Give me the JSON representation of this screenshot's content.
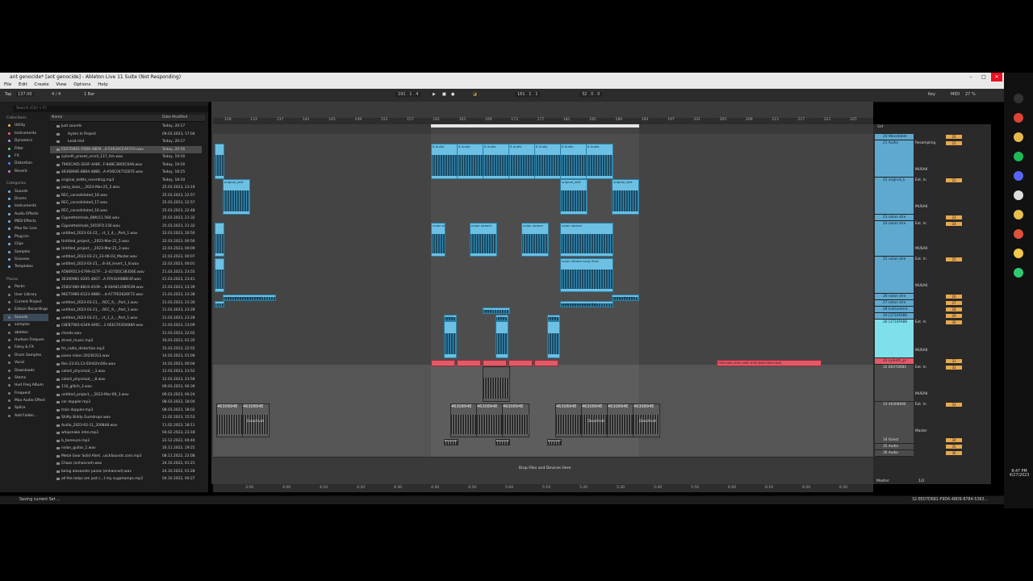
{
  "window": {
    "title": "ant genocide* [ant genocide] - Ableton Live 11 Suite (Not Responding)",
    "minimize": "–",
    "maximize": "□",
    "close": "✕"
  },
  "menu": [
    "File",
    "Edit",
    "Create",
    "View",
    "Options",
    "Help"
  ],
  "control": {
    "tap": "Tap",
    "tempo": "137.00",
    "signature": "4 / 4",
    "quantize": "1 Bar",
    "position": "191 .   1 .   4",
    "loop_start": "161 .   1 .   1",
    "loop_length": "32 .   0 .   0",
    "key": "Key",
    "midi": "MIDI",
    "cpu": "27 %"
  },
  "browser": {
    "search_placeholder": "Search (Ctrl + F)",
    "collections_header": "Collections",
    "collections": [
      {
        "label": "Utility",
        "color": "#e6a84e"
      },
      {
        "label": "Instruments",
        "color": "#e25a68"
      },
      {
        "label": "Dynamics",
        "color": "#b37ee0"
      },
      {
        "label": "Filter",
        "color": "#5fc36a"
      },
      {
        "label": "FX",
        "color": "#5fa9cf"
      },
      {
        "label": "Distortion",
        "color": "#4a7de0"
      },
      {
        "label": "Reverb",
        "color": "#c970c9"
      }
    ],
    "categories_header": "Categories",
    "categories": [
      "Sounds",
      "Drums",
      "Instruments",
      "Audio Effects",
      "MIDI Effects",
      "Max for Live",
      "Plug-ins",
      "Clips",
      "Samples",
      "Grooves",
      "Templates"
    ],
    "places_header": "Places",
    "places": [
      "Packs",
      "User Library",
      "Current Project",
      "Edison Recordings",
      "Sounds",
      "samples",
      "ableton",
      "Hudson Frequen",
      "Foley & FX",
      "Drum Samples",
      "Vocal",
      "Downloads",
      "Stems",
      "Hud Freq Album",
      "Frequent",
      "Max Audio Effect",
      "Splice",
      "Add Folder..."
    ],
    "col_name": "Name",
    "col_date": "Date Modified",
    "files": [
      {
        "name": "Just sounds",
        "date": "Today, 20:17"
      },
      {
        "name": "Hydro In Project",
        "date": "09.03.2023, 17:04"
      },
      {
        "name": "Lead.mid",
        "date": "Today, 20:17"
      },
      {
        "name": "EE07D681-F9D6-48D9...4-5363ACEAFCF0.wav",
        "date": "Today, 20:16"
      },
      {
        "name": "sylenth_preset_scroll_137_Am.wav",
        "date": "Today, 19:16"
      },
      {
        "name": "7965CA65-2EAF-4A8F...F-848C3805C6A8.wav",
        "date": "Today, 19:16"
      },
      {
        "name": "4630894E-8864-4880...A-A56C0471D07E.wav",
        "date": "Today, 18:15"
      },
      {
        "name": "original_kettle_recording.mp3",
        "date": "Today, 18:10"
      },
      {
        "name": "jazzy_bass_-_2023-Mar-25_2.wav",
        "date": "25.03.2023, 23:19"
      },
      {
        "name": "REC_consolidated_18.wav",
        "date": "25.03.2023, 22:57"
      },
      {
        "name": "REC_consolidated_17.wav",
        "date": "25.03.2023, 22:57"
      },
      {
        "name": "REC_consolidated_16.wav",
        "date": "25.03.2023, 22:48"
      },
      {
        "name": "Cigarettelnhale_BWU11.564.wav",
        "date": "25.03.2023, 21:32"
      },
      {
        "name": "Cigarettelnhale_5015FO.156.wav",
        "date": "25.03.2023, 21:32"
      },
      {
        "name": "untitled_2023-03-22_...rt_1_4_-_Part_1.wav",
        "date": "22.03.2023, 20:50"
      },
      {
        "name": "Untitled_project_-_2023-Mar-21_5.wav",
        "date": "22.03.2023, 00:56"
      },
      {
        "name": "Untitled_project_-_2023-Mar-21_3.wav",
        "date": "22.03.2023, 00:09"
      },
      {
        "name": "untitled_2023-03-21_23-06-03_Master.wav",
        "date": "22.03.2023, 00:07"
      },
      {
        "name": "untitled_2023-03-21_...8-34_Insert_1_8.wav",
        "date": "22.03.2023, 00:01"
      },
      {
        "name": "A580FD13-E799-417F-...2-437D5C38356E.wav",
        "date": "21.03.2023, 23:55"
      },
      {
        "name": "36300981-0205-4607...A-FFA32408BE4F.wav",
        "date": "21.03.2023, 23:41"
      },
      {
        "name": "2581F08A-8819-4109-...8-A0A81208FE09.wav",
        "date": "21.03.2023, 23:39"
      },
      {
        "name": "96E75985-6123-4880-...4-A77FE0026F72.wav",
        "date": "21.03.2023, 23:38"
      },
      {
        "name": "untitled_2023-03-21_...REC_9_-_Part_1.wav",
        "date": "21.03.2023, 23:30"
      },
      {
        "name": "untitled_2023-03-21_...REC_9_-_Part_1.wav",
        "date": "21.03.2023, 23:28"
      },
      {
        "name": "untitled_2023-03-21_...rt_1_2_-_Part_1.wav",
        "date": "21.03.2023, 23:28"
      },
      {
        "name": "C8E87083-6349-400C...1-0EECF63D488A.wav",
        "date": "21.03.2023, 23:09"
      },
      {
        "name": "chords.wav",
        "date": "21.03.2023, 22:02"
      },
      {
        "name": "street_music.mp3",
        "date": "16.03.2023, 01:35"
      },
      {
        "name": "fm_radio_distortion.mp3",
        "date": "15.03.2023, 22:55"
      },
      {
        "name": "piano nolan 20230313.wav",
        "date": "14.03.2023, 01:08"
      },
      {
        "name": "Rec-23.03.13-01h02m56s.wav",
        "date": "14.03.2023, 00:04"
      },
      {
        "name": "catart_physmod_-_3.wav",
        "date": "12.03.2023, 23:52"
      },
      {
        "name": "catart_physmod_-_8.wav",
        "date": "12.03.2023, 23:58"
      },
      {
        "name": "110_glitch_3.wav",
        "date": "09.03.2023, 00:39"
      },
      {
        "name": "untitled_project_-_2023-Mar-09_3.wav",
        "date": "09.03.2023, 00:24"
      },
      {
        "name": "car doppler.mp3",
        "date": "08.03.2023, 18:04"
      },
      {
        "name": "train doppler.mp3",
        "date": "08.03.2023, 18:02"
      },
      {
        "name": "Shitty Biddy Gumdrops.wav",
        "date": "11.02.2023, 15:53"
      },
      {
        "name": "Audio_2023-02-11_200848.wav",
        "date": "11.02.2023, 18:11"
      },
      {
        "name": "whipsnake intro.mp3",
        "date": "04.02.2023, 23:18"
      },
      {
        "name": "b_beneuce.mp3",
        "date": "23.12.2022, 04:44"
      },
      {
        "name": "nolan_guitar_1.wav",
        "date": "16.11.2022, 19:25"
      },
      {
        "name": "Metal Gear Solid Alert...uickSounds.com.mp3",
        "date": "08.11.2022, 22:08"
      },
      {
        "name": "Chaos (enhanced).wav",
        "date": "24.10.2022, 01:21"
      },
      {
        "name": "being alexander panos (enhanced).wav",
        "date": "24.10.2022, 01:28"
      },
      {
        "name": "all the ladys are just c...t my sugarlumps.mp3",
        "date": "04.10.2022, 00:27"
      }
    ]
  },
  "ruler": [
    "129",
    "133",
    "137",
    "141",
    "145",
    "149",
    "153",
    "157",
    "161",
    "165",
    "169",
    "173",
    "177",
    "181",
    "185",
    "189",
    "193",
    "197",
    "201",
    "205",
    "209",
    "213",
    "217",
    "221",
    "225"
  ],
  "timeline": [
    "3:50",
    "4:00",
    "4:10",
    "4:20",
    "4:30",
    "4:40",
    "4:50",
    "5:00",
    "5:10",
    "5:20",
    "5:30",
    "5:40",
    "5:50",
    "6:00",
    "6:10",
    "6:20",
    "6:30"
  ],
  "clips": {
    "audio_a": "8 Audio",
    "original_kettle": "original_kett",
    "nolan_ec": "nolan ec",
    "nolan_stream": "nolan stream",
    "nolan_stream_harp": "nolan stream song Harp",
    "nolan_stream_lead": "nolan stream song Lead",
    "nolan_stream_pow": "nolan stream song Pow",
    "lead": "Lead",
    "midi_3710": "3710",
    "red_clip": "7965CA65-2EAF-4A8F-878F-848C3805C6A8",
    "grey_4630": "4630894E",
    "deactivated": "Deactivat",
    "forest": "forest",
    "drop_hint": "Drop Files and Devices Here"
  },
  "mixer": {
    "set_label": "Set",
    "tracks": [
      {
        "name": "20 Wavetable",
        "num": "20",
        "color": "#5fa9cf"
      },
      {
        "name": "21 Audio",
        "num": "21",
        "color": "#5fa9cf",
        "io": "Resampling",
        "out": "MUSAK"
      },
      {
        "name": "22 original_k",
        "num": "22",
        "color": "#5fa9cf",
        "io": "Ext. In",
        "out": "MUSAK"
      },
      {
        "name": "23 nolan stre",
        "num": "23",
        "color": "#5fa9cf"
      },
      {
        "name": "24 nolan stre",
        "num": "24",
        "color": "#5fa9cf",
        "io": "Ext. In",
        "out": "MUSAK"
      },
      {
        "name": "25 nolan stre",
        "num": "25",
        "color": "#5fa9cf",
        "io": "Ext. In",
        "out": "MUSAK"
      },
      {
        "name": "26 nolan stre",
        "num": "26",
        "color": "#5fa9cf"
      },
      {
        "name": "27 nolan stre",
        "num": "27",
        "color": "#5fa9cf"
      },
      {
        "name": "28 Instrument",
        "num": "28",
        "color": "#5fa9cf"
      },
      {
        "name": "29 [3710FAB6",
        "num": "29",
        "color": "#5fa9cf"
      },
      {
        "name": "30 [3710FAB6",
        "num": "30",
        "color": "#7ee0ea",
        "io": "Ext. In",
        "out": "MUSAK"
      },
      {
        "name": "31 sylenth_pr",
        "num": "31",
        "color": "#e25a68"
      },
      {
        "name": "32 EE07D681",
        "num": "32",
        "color": "#4c4c4c",
        "io": "Ext. In",
        "out": "MUSAK"
      },
      {
        "name": "33 4630894E",
        "num": "33",
        "color": "#4c4c4c",
        "io": "Ext. In",
        "out": "Master"
      },
      {
        "name": "34 forest",
        "num": "34",
        "color": "#4c4c4c"
      },
      {
        "name": "35 Audio",
        "num": "35",
        "color": "#4c4c4c"
      },
      {
        "name": "36 Audio",
        "num": "36",
        "color": "#4c4c4c"
      }
    ],
    "master": "Master",
    "master_ratio": "1/2"
  },
  "status": {
    "left": "Saving current Set ...",
    "right": "32-EE07D681-F9D6-48D9-8784-5363..."
  },
  "clock": {
    "time": "8:47 PM",
    "date": "4/27/2023"
  },
  "taskbar_icons": [
    {
      "name": "live",
      "color": "#333"
    },
    {
      "name": "chrome",
      "color": "#db4437"
    },
    {
      "name": "files",
      "color": "#e6b84e"
    },
    {
      "name": "spotify",
      "color": "#1db954"
    },
    {
      "name": "discord",
      "color": "#5865f2"
    },
    {
      "name": "steam",
      "color": "#ddd"
    },
    {
      "name": "folder",
      "color": "#e6c04e"
    },
    {
      "name": "app",
      "color": "#e0503a"
    },
    {
      "name": "bulb",
      "color": "#f2c94c"
    },
    {
      "name": "green",
      "color": "#2ecc71"
    }
  ]
}
